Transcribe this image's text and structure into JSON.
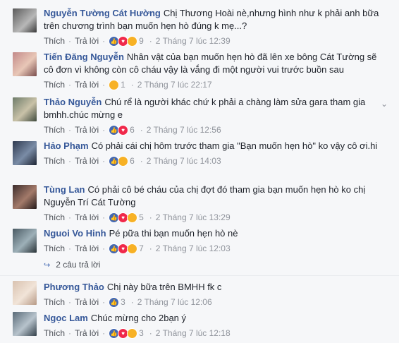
{
  "comments": [
    {
      "author": "Nguyễn Tường Cát Hường",
      "text": "Chị Thương Hoài nè,nhưng hình như k phải anh bữa trên chương trình bạn muốn hẹn hò đúng k mẹ...?",
      "like": "Thích",
      "reply": "Trả lời",
      "count": "9",
      "time": "2 Tháng 7 lúc 12:39",
      "reacts": [
        "like",
        "love",
        "haha"
      ]
    },
    {
      "author": "Tiến Đăng Nguyễn",
      "text": "Nhân vật của bạn muốn hẹn hò đã lên xe bông Cát Tường sẽ cô đơn vì không còn cô cháu vậy là vắng đi một người vui trước buồn sau",
      "like": "Thích",
      "reply": "Trả lời",
      "count": "1",
      "time": "2 Tháng 7 lúc 22:17",
      "reacts": [
        "haha"
      ]
    },
    {
      "author": "Thảo Nguyễn",
      "text": "Chú rể là người khác chứ k phải a chàng làm sửa gara tham gia bmhh.chúc mừng e",
      "like": "Thích",
      "reply": "Trả lời",
      "count": "6",
      "time": "2 Tháng 7 lúc 12:56",
      "reacts": [
        "like",
        "love"
      ]
    },
    {
      "author": "Hảo Phạm",
      "text": "Có phải cái chị hôm trước tham gia \"Bạn muốn hẹn hò\" ko vậy cô ơi.hi",
      "like": "Thích",
      "reply": "Trả lời",
      "count": "6",
      "time": "2 Tháng 7 lúc 14:03",
      "reacts": [
        "like",
        "haha"
      ]
    },
    {
      "author": "Tùng Lan",
      "text": "Có phải cô bé cháu của chị đợt đó tham gia bạn muốn hẹn hò ko chị Nguyễn Trí Cát Tường",
      "like": "Thích",
      "reply": "Trả lời",
      "count": "5",
      "time": "2 Tháng 7 lúc 13:29",
      "reacts": [
        "like",
        "love",
        "wow"
      ]
    },
    {
      "author": "Nguoi Vo Hinh",
      "text": "Pé pữa thi bạn muốn hẹn hò nè",
      "like": "Thích",
      "reply": "Trả lời",
      "count": "7",
      "time": "2 Tháng 7 lúc 12:03",
      "reacts": [
        "like",
        "love",
        "haha"
      ]
    },
    {
      "author": "Phương Thảo",
      "text": "Chị này bữa trên BMHH fk c",
      "like": "Thích",
      "reply": "Trả lời",
      "count": "3",
      "time": "2 Tháng 7 lúc 12:06",
      "reacts": [
        "like"
      ]
    },
    {
      "author": "Ngọc Lam",
      "text": "Chúc mừng cho 2bạn ý",
      "like": "Thích",
      "reply": "Trả lời",
      "count": "3",
      "time": "2 Tháng 7 lúc 12:18",
      "reacts": [
        "like",
        "love",
        "haha"
      ]
    }
  ],
  "replies_link": "2 câu trả lời",
  "colors": {
    "author": "#365899",
    "meta": "#90949c",
    "like": "#4267b2",
    "love": "#f0284a",
    "haha": "#f7b125"
  }
}
